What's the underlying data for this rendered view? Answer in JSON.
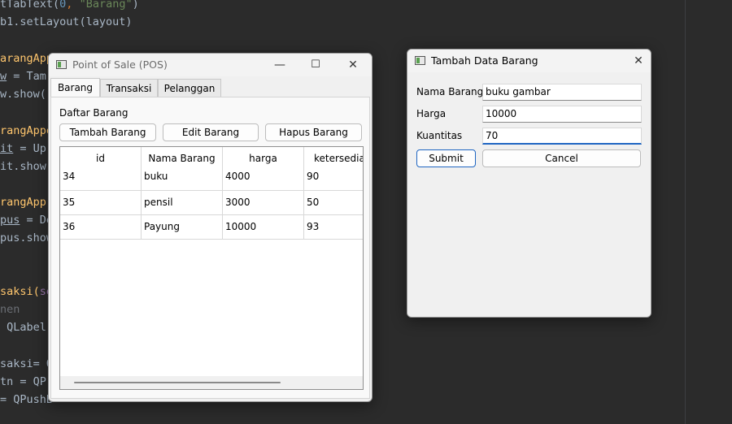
{
  "editor": {
    "lines": [
      {
        "segments": [
          {
            "t": "tTabText(",
            "c": ""
          },
          {
            "t": "0",
            "c": "c-blue"
          },
          {
            "t": ", ",
            "c": "c-orange"
          },
          {
            "t": "\"Barang\"",
            "c": "c-green"
          },
          {
            "t": ")",
            "c": ""
          }
        ]
      },
      {
        "segments": [
          {
            "t": "b1.setLayout(layout)",
            "c": ""
          }
        ]
      },
      {
        "segments": []
      },
      {
        "segments": [
          {
            "t": "arangApp",
            "c": "c-gold"
          }
        ]
      },
      {
        "segments": [
          {
            "t": "w",
            "c": "c-ul"
          },
          {
            "t": " = Tam",
            "c": ""
          }
        ]
      },
      {
        "segments": [
          {
            "t": "w.show(",
            "c": ""
          }
        ]
      },
      {
        "segments": []
      },
      {
        "segments": [
          {
            "t": "rangAppe",
            "c": "c-gold"
          }
        ]
      },
      {
        "segments": [
          {
            "t": "it",
            "c": "c-ul"
          },
          {
            "t": " = Up",
            "c": ""
          }
        ]
      },
      {
        "segments": [
          {
            "t": "it.show",
            "c": ""
          }
        ]
      },
      {
        "segments": []
      },
      {
        "segments": [
          {
            "t": "rangApp",
            "c": "c-gold"
          }
        ]
      },
      {
        "segments": [
          {
            "t": "pus",
            "c": "c-ul"
          },
          {
            "t": " = De",
            "c": ""
          }
        ]
      },
      {
        "segments": [
          {
            "t": "pus.show",
            "c": ""
          }
        ]
      },
      {
        "segments": []
      },
      {
        "segments": []
      },
      {
        "segments": [
          {
            "t": "saksi(",
            "c": "c-gold"
          },
          {
            "t": "se",
            "c": "c-purple"
          }
        ]
      },
      {
        "segments": [
          {
            "t": "nen",
            "c": "c-grey"
          }
        ]
      },
      {
        "segments": [
          {
            "t": " QLabel",
            "c": ""
          }
        ]
      },
      {
        "segments": []
      },
      {
        "segments": [
          {
            "t": "saksi= Q",
            "c": ""
          }
        ]
      },
      {
        "segments": [
          {
            "t": "tn = QP",
            "c": ""
          }
        ]
      },
      {
        "segments": [
          {
            "t": "= QPushB",
            "c": ""
          }
        ]
      }
    ]
  },
  "pos_window": {
    "title": "Point of Sale (POS)",
    "minimize_glyph": "—",
    "maximize_glyph": "☐",
    "close_glyph": "✕",
    "tabs": [
      {
        "label": "Barang",
        "active": true
      },
      {
        "label": "Transaksi",
        "active": false
      },
      {
        "label": "Pelanggan",
        "active": false
      }
    ],
    "section_label": "Daftar Barang",
    "buttons": {
      "add": "Tambah Barang",
      "edit": "Edit Barang",
      "delete": "Hapus Barang"
    },
    "table": {
      "columns": [
        "id",
        "Nama Barang",
        "harga",
        "ketersediaan"
      ],
      "rows": [
        [
          "34",
          "buku",
          "4000",
          "90"
        ],
        [
          "35",
          "pensil",
          "3000",
          "50"
        ],
        [
          "36",
          "Payung",
          "10000",
          "93"
        ]
      ]
    }
  },
  "dialog": {
    "title": "Tambah Data Barang",
    "close_glyph": "✕",
    "fields": [
      {
        "label": "Nama Barang",
        "value": "buku gambar"
      },
      {
        "label": "Harga",
        "value": "10000"
      },
      {
        "label": "Kuantitas",
        "value": "70"
      }
    ],
    "submit_label": "Submit",
    "cancel_label": "Cancel"
  },
  "colors": {
    "editor_bg": "#2b2b2b",
    "focus_accent": "#1f66c2",
    "window_bg": "#f0f0f0"
  }
}
